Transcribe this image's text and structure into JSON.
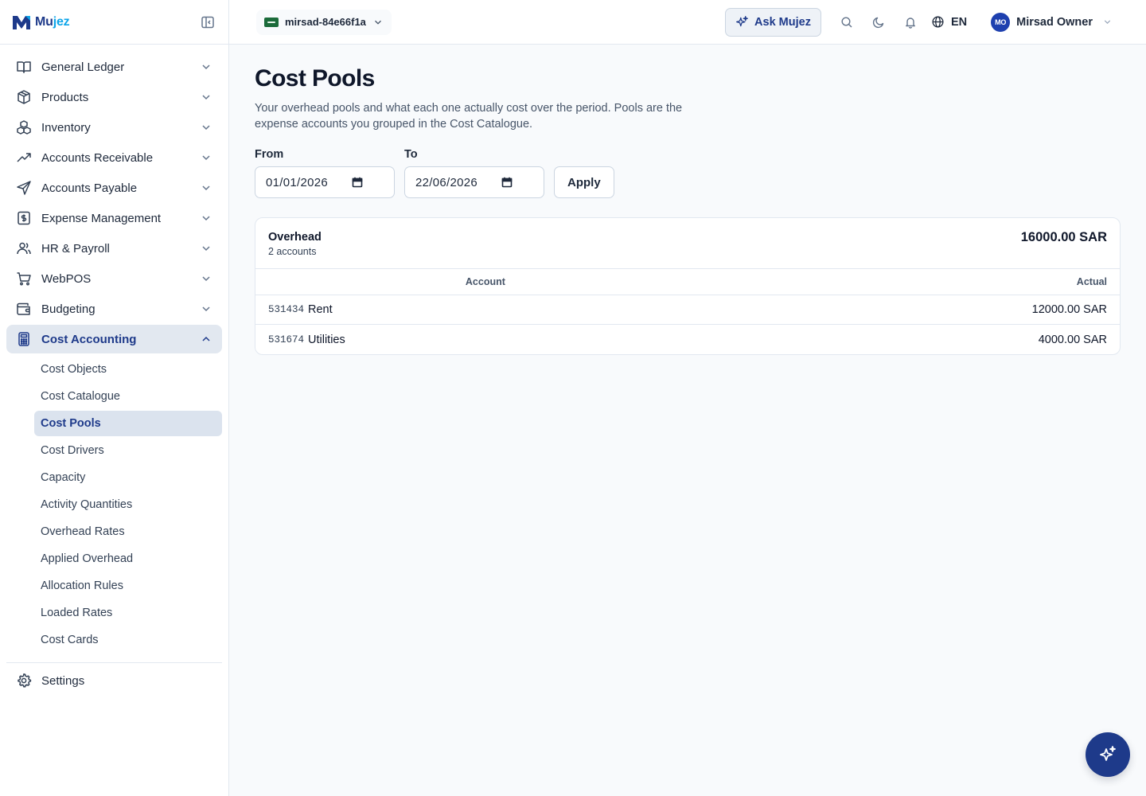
{
  "app": {
    "logo_prefix": "Mu",
    "logo_suffix": "jez",
    "brand_color": "#1e3a8a"
  },
  "sidebar": {
    "items": [
      {
        "label": "General Ledger",
        "icon": "book-icon"
      },
      {
        "label": "Products",
        "icon": "box-icon"
      },
      {
        "label": "Inventory",
        "icon": "boxes-icon"
      },
      {
        "label": "Accounts Receivable",
        "icon": "trending-up-icon"
      },
      {
        "label": "Accounts Payable",
        "icon": "send-icon"
      },
      {
        "label": "Expense Management",
        "icon": "receipt-icon"
      },
      {
        "label": "HR & Payroll",
        "icon": "users-icon"
      },
      {
        "label": "WebPOS",
        "icon": "cart-icon"
      },
      {
        "label": "Budgeting",
        "icon": "wallet-icon"
      },
      {
        "label": "Cost Accounting",
        "icon": "calculator-icon"
      }
    ],
    "cost_accounting_sub": [
      "Cost Objects",
      "Cost Catalogue",
      "Cost Pools",
      "Cost Drivers",
      "Capacity",
      "Activity Quantities",
      "Overhead Rates",
      "Applied Overhead",
      "Allocation Rules",
      "Loaded Rates",
      "Cost Cards"
    ],
    "settings_label": "Settings"
  },
  "topbar": {
    "org_name": "mirsad-84e66f1a",
    "ask_label": "Ask Mujez",
    "language": "EN",
    "user_initials": "MO",
    "user_name": "Mirsad Owner"
  },
  "page": {
    "title": "Cost Pools",
    "description": "Your overhead pools and what each one actually cost over the period. Pools are the expense accounts you grouped in the Cost Catalogue.",
    "filters": {
      "from_label": "From",
      "from_value": "01/01/2026",
      "to_label": "To",
      "to_value": "22/06/2026",
      "apply_label": "Apply"
    },
    "pool": {
      "name": "Overhead",
      "accounts_count": "2 accounts",
      "total": "16000.00 SAR",
      "columns": [
        "Account",
        "Actual"
      ],
      "rows": [
        {
          "code": "531434",
          "name": "Rent",
          "actual": "12000.00 SAR"
        },
        {
          "code": "531674",
          "name": "Utilities",
          "actual": "4000.00 SAR"
        }
      ]
    }
  }
}
